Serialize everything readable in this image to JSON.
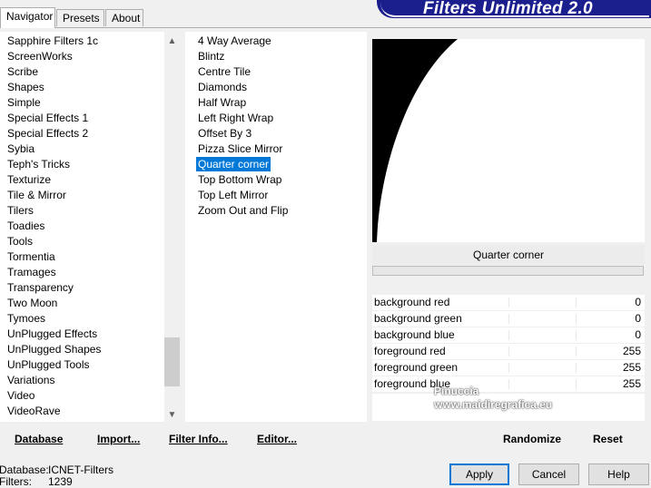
{
  "tabs": [
    "Navigator",
    "Presets",
    "About"
  ],
  "banner_title": "Filters Unlimited 2.0",
  "categories": [
    "Sapphire Filters 1c",
    "ScreenWorks",
    "Scribe",
    "Shapes",
    "Simple",
    "Special Effects 1",
    "Special Effects 2",
    "Sybia",
    "Teph's Tricks",
    "Texturize",
    "Tile & Mirror",
    "Tilers",
    "Toadies",
    "Tools",
    "Tormentia",
    "Tramages",
    "Transparency",
    "Two Moon",
    "Tymoes",
    "UnPlugged Effects",
    "UnPlugged Shapes",
    "UnPlugged Tools",
    "Variations",
    "Video",
    "VideoRave"
  ],
  "filters": [
    "4 Way Average",
    "Blintz",
    "Centre Tile",
    "Diamonds",
    "Half Wrap",
    "Left Right Wrap",
    "Offset By 3",
    "Pizza Slice Mirror",
    "Quarter corner",
    "Top Bottom Wrap",
    "Top Left Mirror",
    "Zoom Out and Flip"
  ],
  "selected_filter_name": "Quarter corner",
  "params": [
    {
      "label": "background red",
      "value": "0"
    },
    {
      "label": "background green",
      "value": "0"
    },
    {
      "label": "background blue",
      "value": "0"
    },
    {
      "label": "foreground red",
      "value": "255"
    },
    {
      "label": "foreground green",
      "value": "255"
    },
    {
      "label": "foreground blue",
      "value": "255"
    }
  ],
  "toolbar": {
    "database": "Database",
    "import": "Import...",
    "filter_info": "Filter Info...",
    "editor": "Editor...",
    "randomize": "Randomize",
    "reset": "Reset"
  },
  "status": {
    "db_label": "Database:",
    "db_value": "ICNET-Filters",
    "filters_label": "Filters:",
    "filters_value": "1239"
  },
  "buttons": {
    "apply": "Apply",
    "cancel": "Cancel",
    "help": "Help"
  },
  "watermark": {
    "line1": "Pinuccia",
    "line2": "www.maidiregrafica.eu"
  },
  "scroll": {
    "up": "▲",
    "down": "▼"
  }
}
